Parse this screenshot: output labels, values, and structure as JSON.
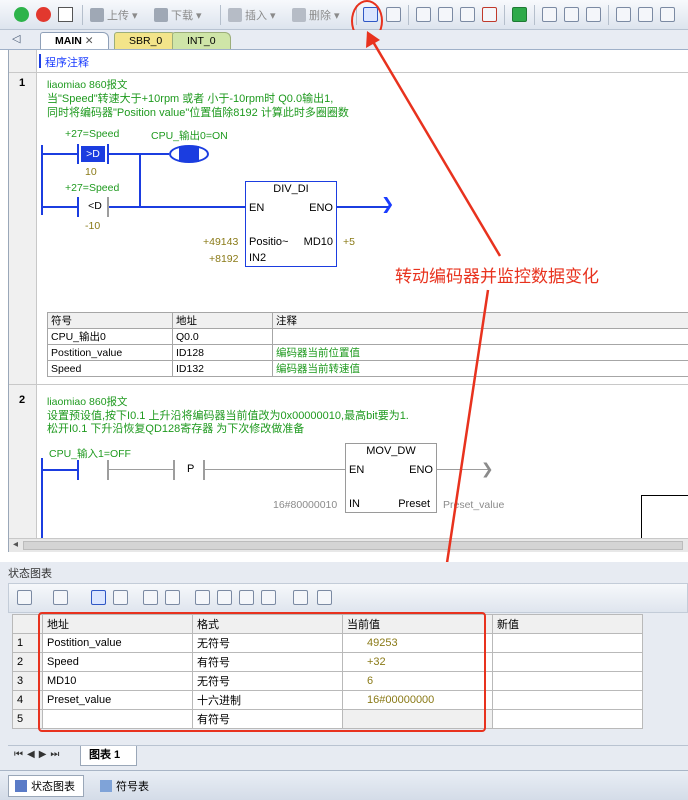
{
  "toolbar": {
    "upload": "上传",
    "download": "下载",
    "insert": "插入",
    "delete": "删除"
  },
  "tabs": [
    "MAIN",
    "SBR_0",
    "INT_0"
  ],
  "editor": {
    "section_label": "程序注释",
    "network1": {
      "number": "1",
      "author": "liaomiao 860报文",
      "comment1": "当\"Speed\"转速大于+10rpm 或者 小于-10rpm时  Q0.0输出1,",
      "comment2": "同时将编码器\"Position value\"位置值除8192 计算此时多圈圈数",
      "c1_value": "+27=Speed",
      "c1_op": ">D",
      "c1_const": "10",
      "coil_label": "CPU_输出0=ON",
      "c2_value": "+27=Speed",
      "c2_op": "<D",
      "c2_const": "-10",
      "block_title": "DIV_DI",
      "en": "EN",
      "eno": "ENO",
      "in1_label": "Positio~",
      "in1_value": "+49143",
      "in2_label": "IN2",
      "in2_value": "+8192",
      "out_label": "MD10",
      "out_value": "+5",
      "symbols": {
        "headers": [
          "符号",
          "地址",
          "注释"
        ],
        "rows": [
          [
            "CPU_输出0",
            "Q0.0",
            ""
          ],
          [
            "Postition_value",
            "ID128",
            "编码器当前位置值"
          ],
          [
            "Speed",
            "ID132",
            "编码器当前转速值"
          ]
        ]
      }
    },
    "network2": {
      "number": "2",
      "author": "liaomiao 860报文",
      "comment1": "设置预设值,按下I0.1 上升沿将编码器当前值改为0x00000010,最高bit要为1.",
      "comment2": "松开I0.1 下升沿恢复QD128寄存器 为下次修改做准备",
      "contact_label": "CPU_输入1=OFF",
      "p_label": "P",
      "block_title": "MOV_DW",
      "en": "EN",
      "eno": "ENO",
      "in_label": "IN",
      "in_value": "16#80000010",
      "out_label": "Preset",
      "out_value": "Preset_value"
    }
  },
  "annotation": "转动编码器并监控数据变化",
  "status_chart": {
    "title": "状态图表",
    "headers": [
      "",
      "地址",
      "格式",
      "当前值",
      "新值"
    ],
    "rows": [
      [
        "1",
        "Postition_value",
        "无符号",
        "49253",
        ""
      ],
      [
        "2",
        "Speed",
        "有符号",
        "+32",
        ""
      ],
      [
        "3",
        "MD10",
        "无符号",
        "6",
        ""
      ],
      [
        "4",
        "Preset_value",
        "十六进制",
        "16#00000000",
        ""
      ],
      [
        "5",
        "",
        "有符号",
        "",
        ""
      ]
    ],
    "sheet_tab": "图表 1"
  },
  "bottom_tabs": [
    "状态图表",
    "符号表"
  ]
}
